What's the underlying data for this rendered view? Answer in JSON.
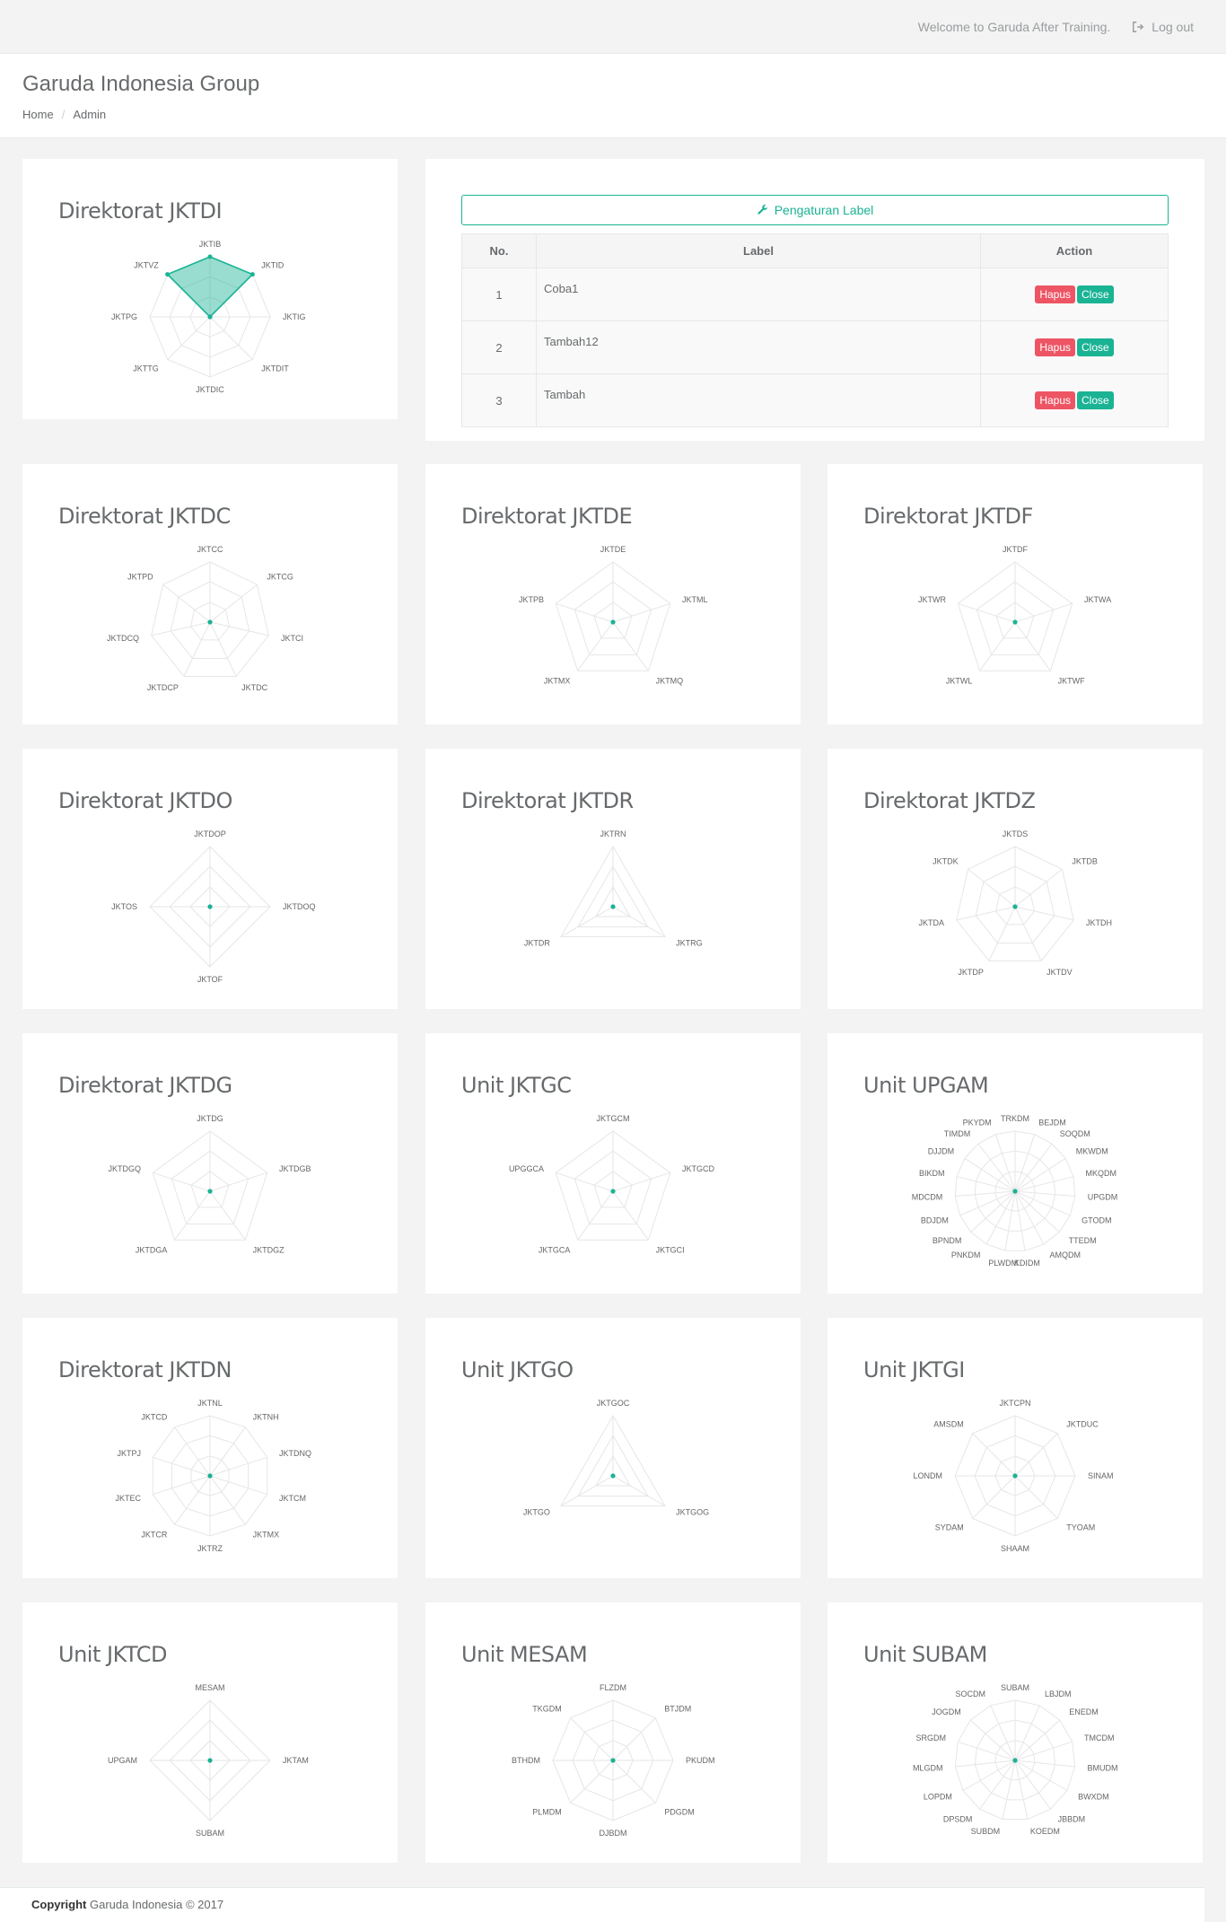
{
  "topbar": {
    "welcome": "Welcome to Garuda After Training.",
    "logout_label": "Log out"
  },
  "header": {
    "title": "Garuda Indonesia Group",
    "breadcrumb": [
      "Home",
      "Admin"
    ]
  },
  "accent_color": "#1ab394",
  "label_panel": {
    "button_label": "Pengaturan Label",
    "columns": [
      "No.",
      "Label",
      "Action"
    ],
    "rows": [
      {
        "no": "1",
        "label": "Coba1"
      },
      {
        "no": "2",
        "label": "Tambah12"
      },
      {
        "no": "3",
        "label": "Tambah"
      }
    ],
    "delete_label": "Hapus",
    "close_label": "Close"
  },
  "charts": [
    {
      "title": "Direktorat JKTDI",
      "labels": [
        "JKTIB",
        "JKTID",
        "JKTIG",
        "JKTDIT",
        "JKTDIC",
        "JKTTG",
        "JKTPG",
        "JKTVZ"
      ],
      "values": [
        1,
        1,
        0,
        0,
        0,
        0,
        0,
        1
      ]
    },
    {
      "title": "Direktorat JKTDC",
      "labels": [
        "JKTCC",
        "JKTCG",
        "JKTCI",
        "JKTDC",
        "JKTDCP",
        "JKTDCQ",
        "JKTPD"
      ]
    },
    {
      "title": "Direktorat JKTDE",
      "labels": [
        "JKTDE",
        "JKTML",
        "JKTMQ",
        "JKTMX",
        "JKTPB"
      ]
    },
    {
      "title": "Direktorat JKTDF",
      "labels": [
        "JKTDF",
        "JKTWA",
        "JKTWF",
        "JKTWL",
        "JKTWR"
      ]
    },
    {
      "title": "Direktorat JKTDO",
      "labels": [
        "JKTDOP",
        "JKTDOQ",
        "JKTOF",
        "JKTOS"
      ]
    },
    {
      "title": "Direktorat JKTDR",
      "labels": [
        "JKTRN",
        "JKTRG",
        "JKTDR"
      ]
    },
    {
      "title": "Direktorat JKTDZ",
      "labels": [
        "JKTDS",
        "JKTDB",
        "JKTDH",
        "JKTDV",
        "JKTDP",
        "JKTDA",
        "JKTDK"
      ]
    },
    {
      "title": "Direktorat JKTDG",
      "labels": [
        "JKTDG",
        "JKTDGB",
        "JKTDGZ",
        "JKTDGA",
        "JKTDGQ"
      ]
    },
    {
      "title": "Unit JKTGC",
      "labels": [
        "JKTGCM",
        "JKTGCD",
        "JKTGCI",
        "JKTGCA",
        "UPGGCA"
      ]
    },
    {
      "title": "Unit UPGAM",
      "labels": [
        "TRKDM",
        "BEJDM",
        "SOQDM",
        "MKWDM",
        "MKQDM",
        "UPGDM",
        "GTODM",
        "TTEDM",
        "AMQDM",
        "KDIDM",
        "PLWDM",
        "PNKDM",
        "BPNDM",
        "BDJDM",
        "MDCDM",
        "BIKDM",
        "DJJDM",
        "TIMDM",
        "PKYDM"
      ]
    },
    {
      "title": "Direktorat JKTDN",
      "labels": [
        "JKTNL",
        "JKTNH",
        "JKTDNQ",
        "JKTCM",
        "JKTMX",
        "JKTRZ",
        "JKTCR",
        "JKTEC",
        "JKTPJ",
        "JKTCD"
      ]
    },
    {
      "title": "Unit JKTGO",
      "labels": [
        "JKTGOC",
        "JKTGOG",
        "JKTGO"
      ]
    },
    {
      "title": "Unit JKTGI",
      "labels": [
        "JKTCPN",
        "JKTDUC",
        "SINAM",
        "TYOAM",
        "SHAAM",
        "SYDAM",
        "LONDM",
        "AMSDM"
      ]
    },
    {
      "title": "Unit JKTCD",
      "labels": [
        "MESAM",
        "JKTAM",
        "SUBAM",
        "UPGAM"
      ]
    },
    {
      "title": "Unit MESAM",
      "labels": [
        "FLZDM",
        "BTJDM",
        "PKUDM",
        "PDGDM",
        "DJBDM",
        "PLMDM",
        "BTHDM",
        "TKGDM"
      ]
    },
    {
      "title": "Unit SUBAM",
      "labels": [
        "SUBAM",
        "LBJDM",
        "ENEDM",
        "TMCDM",
        "BMUDM",
        "BWXDM",
        "JBBDM",
        "KOEDM",
        "SUBDM",
        "DPSDM",
        "LOPDM",
        "MLGDM",
        "SRGDM",
        "JOGDM",
        "SOCDM"
      ]
    }
  ],
  "footer": {
    "copyright_label": "Copyright",
    "text": "Garuda Indonesia © 2017"
  }
}
